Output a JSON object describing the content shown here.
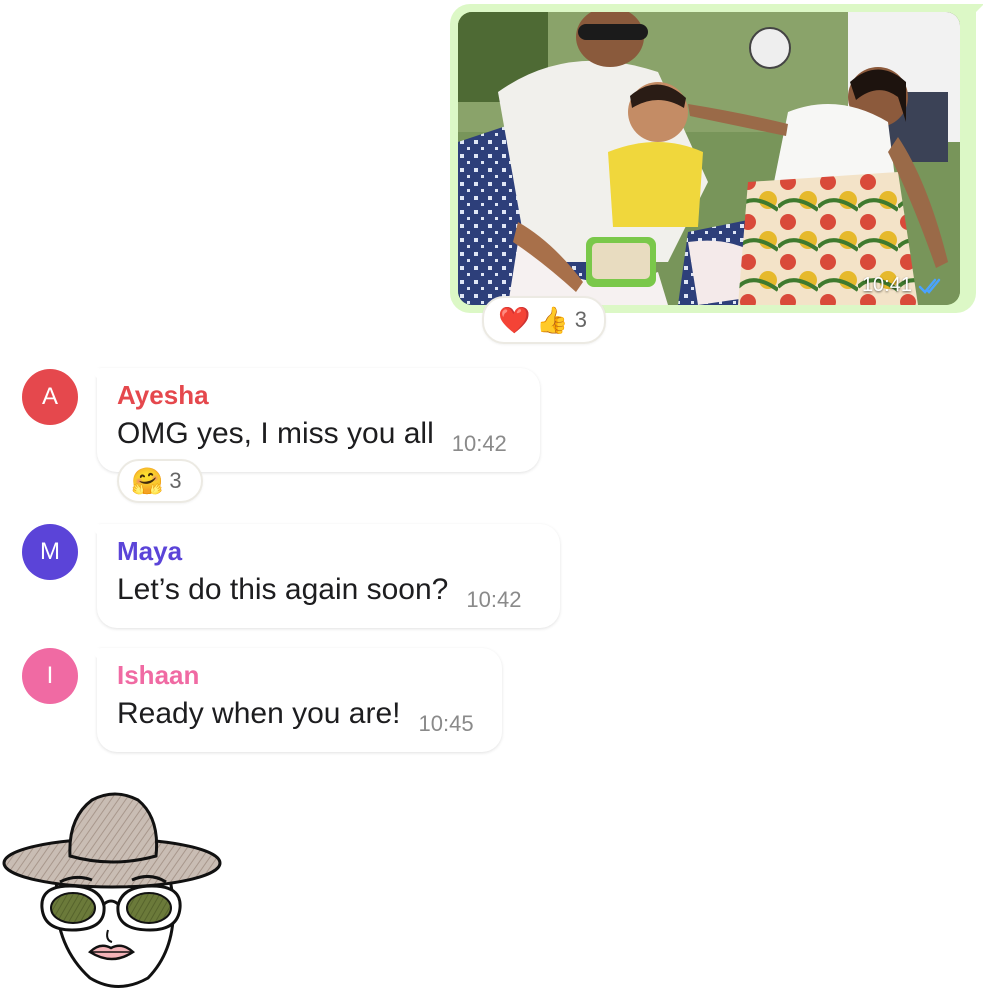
{
  "outgoing": {
    "time": "10:41",
    "reactions": {
      "emojis": [
        "❤️",
        "👍"
      ],
      "count": "3"
    }
  },
  "messages": [
    {
      "initial": "A",
      "sender": "Ayesha",
      "text": "OMG yes, I miss you all",
      "time": "10:42",
      "color": "#e5484d",
      "reactions": {
        "emoji": "🤗",
        "count": "3"
      }
    },
    {
      "initial": "M",
      "sender": "Maya",
      "text": "Let’s do this again soon?",
      "time": "10:42",
      "color": "#5b44d8"
    },
    {
      "initial": "I",
      "sender": "Ishaan",
      "text": "Ready when you are!",
      "time": "10:45",
      "color": "#f06aa3"
    }
  ],
  "colors": {
    "outgoing_bubble": "#dcf8c6",
    "read_tick": "#4aa3ff"
  },
  "icons": {
    "read_receipt": "double-check-icon",
    "sticker": "woman-hat-sunglasses-sticker"
  }
}
